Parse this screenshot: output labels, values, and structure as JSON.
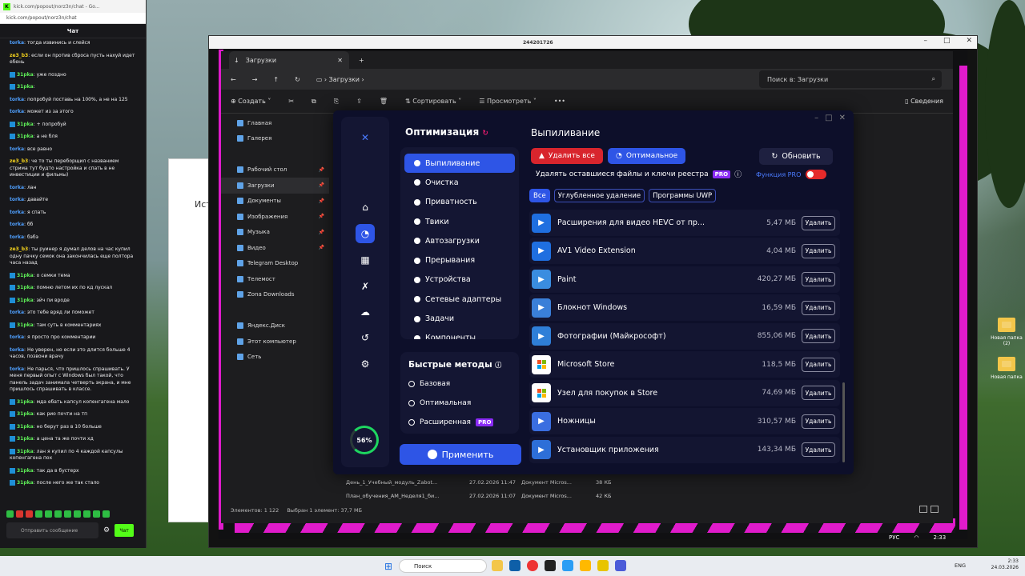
{
  "desktop": {
    "icons": [
      "Новая папка (2)",
      "Новая папка"
    ]
  },
  "chat": {
    "tab_title": "kick.com/popout/norz3n/chat - Go...",
    "url": "kick.com/popout/norz3n/chat",
    "header": "Чат",
    "messages": [
      {
        "user": "torka",
        "color": "#4fa0ff",
        "badge": false,
        "text": "тогда извинись и слейся"
      },
      {
        "user": "ze3_b3",
        "color": "#f7d51c",
        "badge": false,
        "text": "если он против сброса пусть нахуй идет ебень"
      },
      {
        "user": "31pka",
        "color": "#5ff058",
        "badge": true,
        "text": "уже поздно"
      },
      {
        "user": "31pka",
        "color": "#5ff058",
        "badge": true,
        "text": ""
      },
      {
        "user": "torka",
        "color": "#4fa0ff",
        "badge": false,
        "text": "попробуй поставь на 100%, а не на 125"
      },
      {
        "user": "torka",
        "color": "#4fa0ff",
        "badge": false,
        "text": "может из за этого"
      },
      {
        "user": "31pka",
        "color": "#5ff058",
        "badge": true,
        "text": "+ попробуй"
      },
      {
        "user": "31pka",
        "color": "#5ff058",
        "badge": true,
        "text": "а не бля"
      },
      {
        "user": "torka",
        "color": "#4fa0ff",
        "badge": false,
        "text": "все равно"
      },
      {
        "user": "ze3_b3",
        "color": "#f7d51c",
        "badge": false,
        "text": "че то ты переборщил с названием стрима тут будто настройка и спать в не инвестиции и фильмы)"
      },
      {
        "user": "torka",
        "color": "#4fa0ff",
        "badge": false,
        "text": "лан"
      },
      {
        "user": "torka",
        "color": "#4fa0ff",
        "badge": false,
        "text": "давайте"
      },
      {
        "user": "torka",
        "color": "#4fa0ff",
        "badge": false,
        "text": "я спать"
      },
      {
        "user": "torka",
        "color": "#4fa0ff",
        "badge": false,
        "text": "бб"
      },
      {
        "user": "torka",
        "color": "#4fa0ff",
        "badge": false,
        "text": "бэбэ"
      },
      {
        "user": "ze3_b3",
        "color": "#f7d51c",
        "badge": false,
        "text": "ты руинер я думал делов на час купил одну пачку семок она закончилась еще полтора часа назад"
      },
      {
        "user": "31pka",
        "color": "#5ff058",
        "badge": true,
        "text": "о семки тема"
      },
      {
        "user": "31pka",
        "color": "#5ff058",
        "badge": true,
        "text": "помню летом их по кд лускал"
      },
      {
        "user": "31pka",
        "color": "#5ff058",
        "badge": true,
        "text": "эйч пи вроде"
      },
      {
        "user": "torka",
        "color": "#4fa0ff",
        "badge": false,
        "text": "это тебе вряд ли поможет"
      },
      {
        "user": "31pka",
        "color": "#5ff058",
        "badge": true,
        "text": "там суть в комментариях"
      },
      {
        "user": "torka",
        "color": "#4fa0ff",
        "badge": false,
        "text": "я просто про комментарии"
      },
      {
        "user": "torka",
        "color": "#4fa0ff",
        "badge": false,
        "text": "Не уверен, но если это длится больше 4 часов, позвони врачу"
      },
      {
        "user": "torka",
        "color": "#4fa0ff",
        "badge": false,
        "text": "Не парься, что пришлось спрашивать. У меня первый опыт с Windows был такой, что панель задач занимала четверть экрана, и мне пришлось спрашивать в классе."
      },
      {
        "user": "31pka",
        "color": "#5ff058",
        "badge": true,
        "text": "мда ебать капсул копенгагена мало"
      },
      {
        "user": "31pka",
        "color": "#5ff058",
        "badge": true,
        "text": "как рио почти на тп"
      },
      {
        "user": "31pka",
        "color": "#5ff058",
        "badge": true,
        "text": "но берут раз в 10 больше"
      },
      {
        "user": "31pka",
        "color": "#5ff058",
        "badge": true,
        "text": "а цена та же почти хд"
      },
      {
        "user": "31pka",
        "color": "#5ff058",
        "badge": true,
        "text": "лан я купил по 4 каждой капсулы копенгагена пох"
      },
      {
        "user": "31pka",
        "color": "#5ff058",
        "badge": true,
        "text": "так да в бустерх"
      },
      {
        "user": "31pka",
        "color": "#5ff058",
        "badge": true,
        "text": "после него же так стало"
      }
    ],
    "input_placeholder": "Отправить сообщение",
    "send_label": "Чат"
  },
  "chrome_bg": {
    "title": "Ист"
  },
  "window": {
    "number": "244201726"
  },
  "explorer": {
    "tab": "Загрузки",
    "breadcrumb": "Загрузки",
    "search_placeholder": "Поиск в: Загрузки",
    "toolbar": {
      "create": "Создать",
      "sort": "Сортировать",
      "view": "Просмотреть",
      "details": "Сведения"
    },
    "sidebar": [
      {
        "label": "Главная",
        "pin": false
      },
      {
        "label": "Галерея",
        "pin": false
      },
      {
        "label": "",
        "pin": false
      },
      {
        "label": "Рабочий стол",
        "pin": true
      },
      {
        "label": "Загрузки",
        "pin": true
      },
      {
        "label": "Документы",
        "pin": true
      },
      {
        "label": "Изображения",
        "pin": true
      },
      {
        "label": "Музыка",
        "pin": true
      },
      {
        "label": "Видео",
        "pin": true
      },
      {
        "label": "Telegram Desktop",
        "pin": false
      },
      {
        "label": "Телемост",
        "pin": false
      },
      {
        "label": "Zona Downloads",
        "pin": false
      },
      {
        "label": "",
        "pin": false
      },
      {
        "label": "Яндекс.Диск",
        "pin": false
      },
      {
        "label": "Этот компьютер",
        "pin": false
      },
      {
        "label": "Сеть",
        "pin": false
      }
    ],
    "files": [
      {
        "name": "День_1_Учебный_модуль_Zabot...",
        "date": "27.02.2026 11:47",
        "type": "Документ Micros...",
        "size": "38 КБ"
      },
      {
        "name": "План_обучения_АМ_Неделя1_би...",
        "date": "27.02.2026 11:07",
        "type": "Документ Micros...",
        "size": "42 КБ"
      }
    ],
    "status_items": "Элементов: 1 122",
    "status_selected": "Выбран 1 элемент: 37,7 МБ"
  },
  "app": {
    "title": "Оптимизация",
    "progress": "56%",
    "menu": [
      "Выпиливание",
      "Очистка",
      "Приватность",
      "Твики",
      "Автозагрузки",
      "Прерывания",
      "Устройства",
      "Сетевые адаптеры",
      "Задачи",
      "Компоненты"
    ],
    "quick_title": "Быстрые методы",
    "quick": [
      "Базовая",
      "Оптимальная",
      "Расширенная"
    ],
    "pro": "PRO",
    "apply": "Применить",
    "right_title": "Выпиливание",
    "delete_all": "Удалить все",
    "optimal": "Оптимальное",
    "refresh": "Обновить",
    "reg_text": "Удалять оставшиеся файлы и ключи реестра",
    "pro_func": "Функция PRO",
    "filters": [
      "Все",
      "Углубленное удаление",
      "Программы UWP"
    ],
    "items": [
      {
        "name": "Расширения для видео HEVC от пр...",
        "size": "5,47 МБ",
        "color": "#1f6fe0"
      },
      {
        "name": "AV1 Video Extension",
        "size": "4,04 МБ",
        "color": "#1f6fe0"
      },
      {
        "name": "Paint",
        "size": "420,27 МБ",
        "color": "#3a8de0"
      },
      {
        "name": "Блокнот Windows",
        "size": "16,59 МБ",
        "color": "#3a7fd8"
      },
      {
        "name": "Фотографии (Майкрософт)",
        "size": "855,06 МБ",
        "color": "#2f7fd8"
      },
      {
        "name": "Microsoft Store",
        "size": "118,5 МБ",
        "color": "#ffffff"
      },
      {
        "name": "Узел для покупок в Store",
        "size": "74,69 МБ",
        "color": "#ffffff"
      },
      {
        "name": "Ножницы",
        "size": "310,57 МБ",
        "color": "#3a6ee0"
      },
      {
        "name": "Установщик приложения",
        "size": "143,34 МБ",
        "color": "#2d6fd8"
      }
    ],
    "delete_label": "Удалить"
  },
  "taskbar": {
    "search": "Поиск",
    "lang": "ENG",
    "time": "2:33",
    "date": "24.03.2026",
    "mini_lang": "РУС",
    "mini_time": "2:33"
  }
}
